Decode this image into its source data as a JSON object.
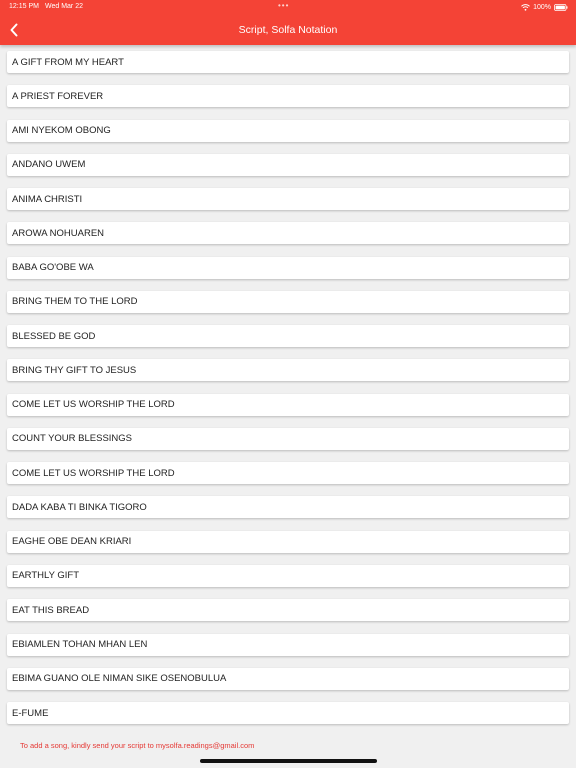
{
  "status_bar": {
    "time": "12:15 PM",
    "date": "Wed Mar 22",
    "battery": "100%"
  },
  "header": {
    "title": "Script, Solfa Notation",
    "background_color": "#f44336",
    "back_icon": "chevron-left-icon"
  },
  "songs": [
    "A GIFT FROM MY HEART",
    "A PRIEST FOREVER",
    "AMI NYEKOM OBONG",
    "ANDANO UWEM",
    "ANIMA CHRISTI",
    "AROWA NOHUAREN",
    "BABA GO'OBE WA",
    "BRING THEM TO THE LORD",
    "BLESSED BE GOD",
    "BRING THY GIFT TO JESUS",
    "COME LET US WORSHIP THE LORD",
    "COUNT YOUR BLESSINGS",
    "COME LET US WORSHIP THE LORD",
    "DADA KABA TI BINKA TIGORO",
    "EAGHE OBE DEAN KRIARI",
    "EARTHLY GIFT",
    "EAT THIS BREAD",
    "EBIAMLEN TOHAN MHAN LEN",
    "EBIMA GUANO OLE NIMAN SIKE OSENOBULUA",
    "E-FUME"
  ],
  "footer": {
    "note": "To add a song, kindly send your script to mysolfa.readings@gmail.com"
  }
}
